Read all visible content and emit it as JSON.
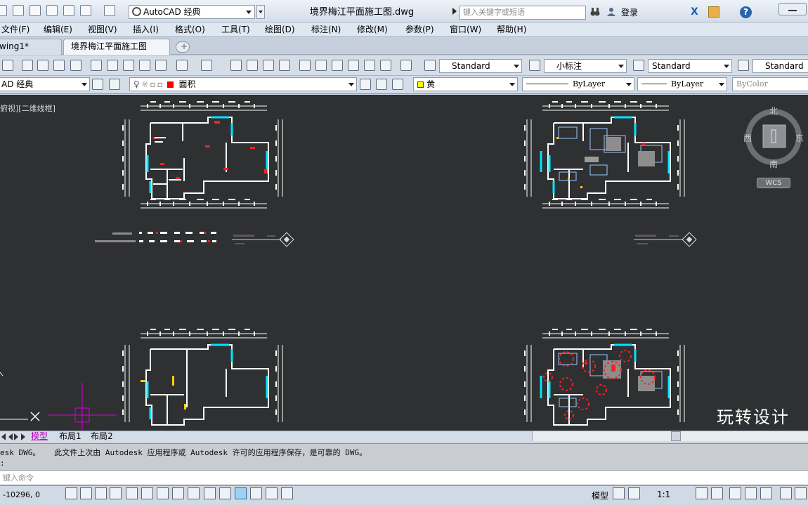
{
  "titlebar": {
    "workspace": "AutoCAD 经典",
    "document_title": "境界梅江平面施工图.dwg",
    "search_placeholder": "键入关键字或短语",
    "login": "登录"
  },
  "menubar": {
    "items": [
      "文件(F)",
      "编辑(E)",
      "视图(V)",
      "插入(I)",
      "格式(O)",
      "工具(T)",
      "绘图(D)",
      "标注(N)",
      "修改(M)",
      "参数(P)",
      "窗口(W)",
      "帮助(H)"
    ]
  },
  "tabs": [
    {
      "label": "wing1*",
      "active": false
    },
    {
      "label": "境界梅江平面施工图*",
      "active": true
    }
  ],
  "toolbar1": {
    "text_style": "Standard",
    "dim_style": "小标注",
    "table_style": "Standard",
    "mleader_style": "Standard"
  },
  "toolbar2": {
    "workspace": "AD 经典",
    "layer": "面积",
    "layer_color": "#ff0000",
    "color": "黄",
    "color_swatch": "#ffff00",
    "linetype": "ByLayer",
    "lineweight": "ByLayer",
    "plotstyle": "ByColor"
  },
  "viewport": {
    "label": "俯视][二维线框]",
    "compass": {
      "north": "北",
      "south": "南",
      "east": "东",
      "west": "西"
    },
    "wcs": "WCS",
    "watermark": "玩转设计",
    "drawing_colors": {
      "wall": "#ffffff",
      "cyan": "#00e5ff",
      "red": "#ff2020",
      "magenta": "#d400d4",
      "background": "#2f3032"
    }
  },
  "layout_tabs": [
    "模型",
    "布局1",
    "布局2"
  ],
  "command": {
    "history_1": "esk DWG。   此文件上次由 Autodesk 应用程序或 Autodesk 许可的应用程序保存，是可靠的 DWG。",
    "history_2": ":",
    "input_placeholder": "键入命令"
  },
  "status": {
    "coords": "-10296, 0",
    "model": "模型",
    "scale": "1:1"
  }
}
